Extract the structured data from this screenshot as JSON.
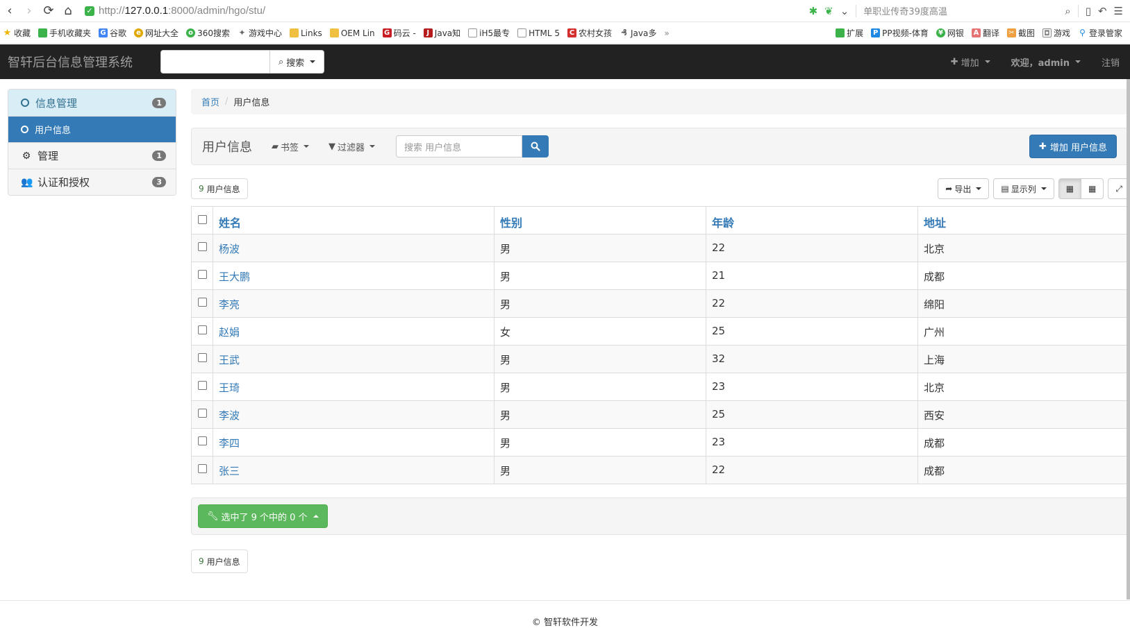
{
  "browser": {
    "url_scheme": "http://",
    "url_host": "127.0.0.1",
    "url_rest": ":8000/admin/hgo/stu/",
    "hot_search": "单职业传奇39度高温",
    "bookmarks": [
      {
        "label": "收藏",
        "color": "#f0b400"
      },
      {
        "label": "手机收藏夹",
        "color": "#3cb34a"
      },
      {
        "label": "谷歌",
        "color": "#4285f4"
      },
      {
        "label": "网址大全",
        "color": "#e0a800"
      },
      {
        "label": "360搜索",
        "color": "#3cb34a"
      },
      {
        "label": "游戏中心",
        "color": "#666666"
      },
      {
        "label": "Links",
        "color": "#f0c040"
      },
      {
        "label": "OEM Lin",
        "color": "#f0c040"
      },
      {
        "label": "码云 -",
        "color": "#c71d23"
      },
      {
        "label": "Java知",
        "color": "#b71c1c"
      },
      {
        "label": "iH5最专",
        "color": "#999999"
      },
      {
        "label": "HTML 5",
        "color": "#999999"
      },
      {
        "label": "农村女孩",
        "color": "#d32f2f"
      },
      {
        "label": "Java多",
        "color": "#555555"
      }
    ],
    "bookmarks_more": "»",
    "bookmarks_right": [
      "扩展",
      "PP视频-体育",
      "网银",
      "翻译",
      "截图",
      "游戏",
      "登录管家"
    ]
  },
  "navbar": {
    "brand": "智轩后台信息管理系统",
    "search_label": "搜索",
    "add_label": "增加",
    "welcome_label": "欢迎，admin",
    "logout_label": "注销"
  },
  "sidebar": {
    "items": [
      {
        "label": "信息管理",
        "badge": "1"
      },
      {
        "label": "用户信息"
      },
      {
        "label": "管理",
        "badge": "1"
      },
      {
        "label": "认证和授权",
        "badge": "3"
      }
    ]
  },
  "breadcrumb": {
    "home": "首页",
    "current": "用户信息"
  },
  "toolbar": {
    "title": "用户信息",
    "bookmarks_label": "书签",
    "filter_label": "过滤器",
    "search_placeholder": "搜索 用户信息",
    "add_button": "增加 用户信息"
  },
  "count": {
    "num": "9",
    "label": "用户信息"
  },
  "tools": {
    "export_label": "导出",
    "columns_label": "显示列"
  },
  "table": {
    "headers": [
      "姓名",
      "性别",
      "年龄",
      "地址"
    ],
    "rows": [
      {
        "name": "杨波",
        "gender": "男",
        "age": "22",
        "address": "北京"
      },
      {
        "name": "王大鹏",
        "gender": "男",
        "age": "21",
        "address": "成都"
      },
      {
        "name": "李亮",
        "gender": "男",
        "age": "22",
        "address": "绵阳"
      },
      {
        "name": "赵娟",
        "gender": "女",
        "age": "25",
        "address": "广州"
      },
      {
        "name": "王武",
        "gender": "男",
        "age": "32",
        "address": "上海"
      },
      {
        "name": "王琦",
        "gender": "男",
        "age": "23",
        "address": "北京"
      },
      {
        "name": "李波",
        "gender": "男",
        "age": "25",
        "address": "西安"
      },
      {
        "name": "李四",
        "gender": "男",
        "age": "23",
        "address": "成都"
      },
      {
        "name": "张三",
        "gender": "男",
        "age": "22",
        "address": "成都"
      }
    ]
  },
  "actions": {
    "selected_label": "选中了 9 个中的 0 个"
  },
  "footer": {
    "text": "© 智轩软件开发"
  },
  "colors": {
    "primary": "#337ab7",
    "success": "#5cb85c",
    "navbar": "#222222"
  }
}
